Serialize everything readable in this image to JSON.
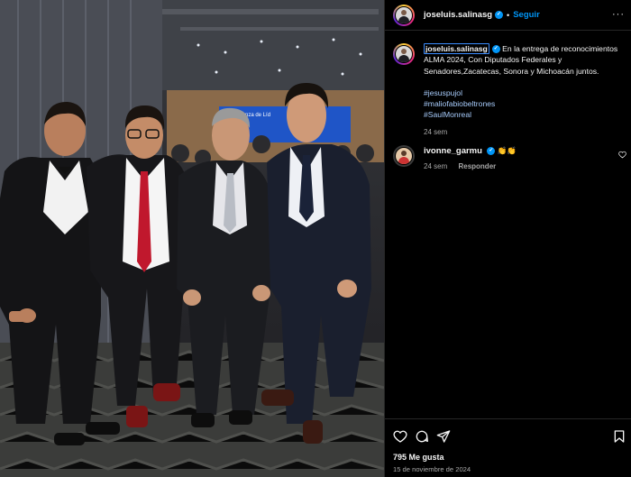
{
  "post": {
    "username": "joseluis.salinasg",
    "follow_label": "Seguir",
    "more_label": "···",
    "caption": "En la entrega de reconocimientos ALMA 2024, Con Diputados Federales y Senadores,Zacatecas, Sonora y Michoacán juntos.",
    "hashtags": [
      "#jesuspujol",
      "#maliofabiobeltrones",
      "#SaulMonreal"
    ],
    "caption_time": "24 sem",
    "photo_banner_text": "Alianza de Líd"
  },
  "comment": {
    "username": "ivonne_garmu",
    "emoji": "👏👏",
    "time": "24 sem",
    "reply_label": "Responder"
  },
  "footer": {
    "likes": "795 Me gusta",
    "date": "15 de noviembre de 2024"
  },
  "icons": [
    "heart-icon",
    "comment-icon",
    "share-icon",
    "bookmark-icon",
    "verified-badge-icon",
    "more-icon"
  ],
  "colors": {
    "accent": "#0095f6",
    "hashtag": "#a7cbfb",
    "muted": "#a8a8a8",
    "background": "#000000"
  }
}
